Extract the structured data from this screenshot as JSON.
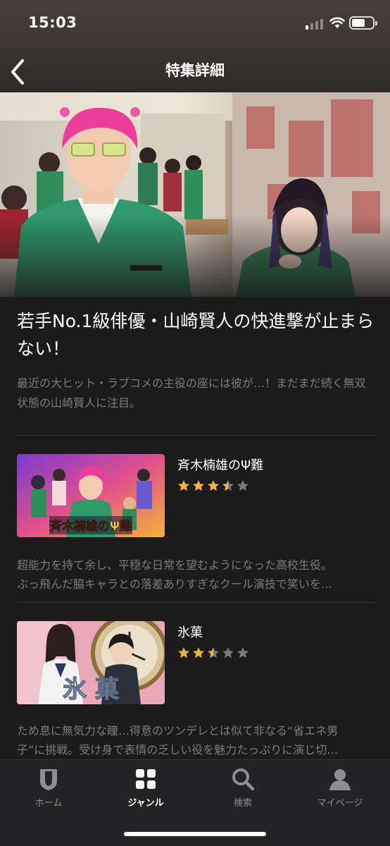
{
  "status_bar": {
    "time": "15:03"
  },
  "nav": {
    "title": "特集詳細",
    "back_icon": "chevron-left-icon"
  },
  "feature": {
    "title": "若手No.1級俳優・山崎賢人の快進撃が止まらない！",
    "description": "最近の大ヒット・ラブコメの主役の座には彼が…！まだまだ続く無双状態の山崎賢人に注目。"
  },
  "items": [
    {
      "title": "斉木楠雄のΨ難",
      "rating": 3.5,
      "thumb_caption": "斉木楠雄のΨ難",
      "description_lines": [
        "超能力を持て余し、平穏な日常を望むようになった高校生役。",
        "ぶっ飛んだ脇キャラとの落差ありすぎなクール演技で笑いを…"
      ]
    },
    {
      "title": "氷菓",
      "rating": 2.5,
      "thumb_caption": "氷 菓",
      "description_lines": [
        "ため息に無気力な瞳…得意のツンデレとは似て非なる“省エネ男",
        "子”に挑戦。受け身で表情の乏しい役を魅力たっぷりに演じ切…"
      ]
    }
  ],
  "tabs": [
    {
      "label": "ホーム",
      "icon": "home-shield-icon",
      "active": false
    },
    {
      "label": "ジャンル",
      "icon": "grid-icon",
      "active": true
    },
    {
      "label": "検索",
      "icon": "search-icon",
      "active": false
    },
    {
      "label": "マイページ",
      "icon": "user-icon",
      "active": false
    }
  ],
  "colors": {
    "star_on": "#f2b436",
    "star_off": "#7a7a7c",
    "background": "#1b1b1c"
  }
}
